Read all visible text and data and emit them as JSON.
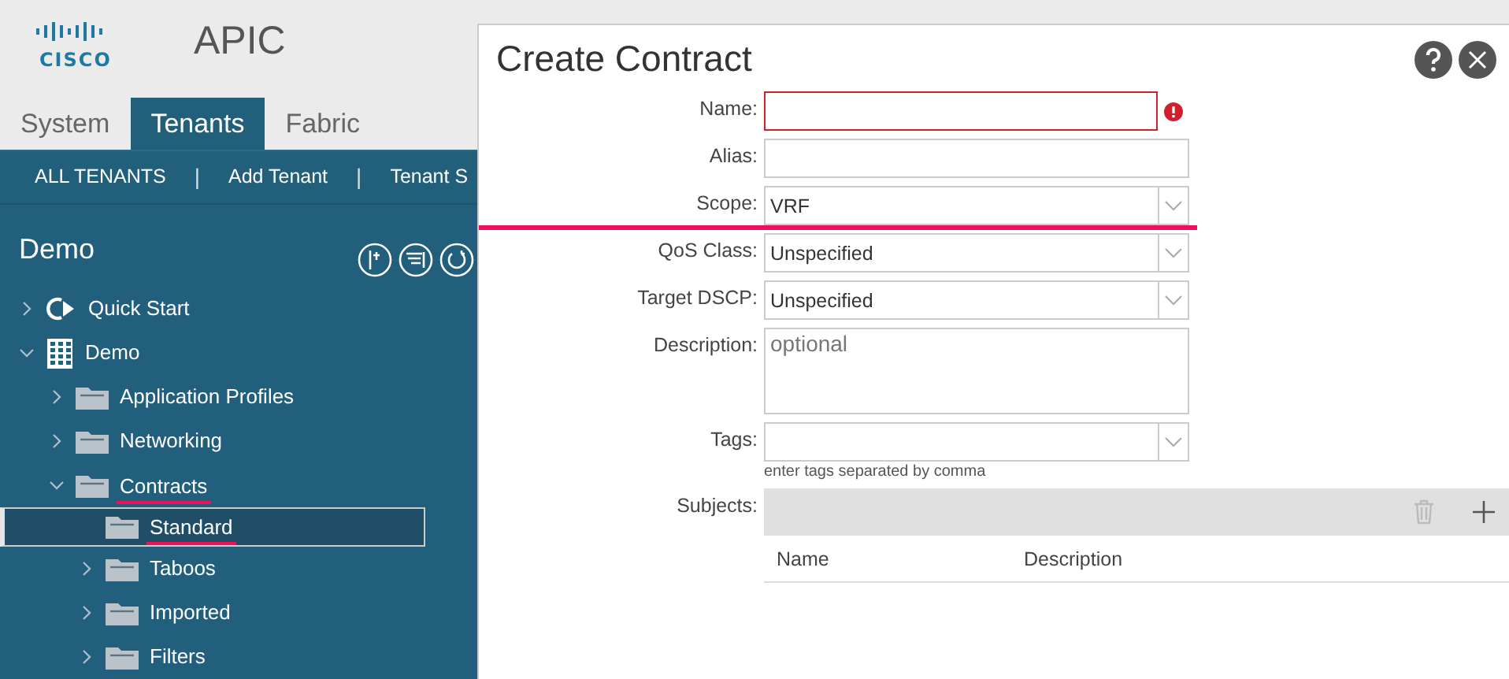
{
  "header": {
    "logo": "CISCO",
    "app_name": "APIC"
  },
  "tabs": [
    {
      "label": "System",
      "selected": false
    },
    {
      "label": "Tenants",
      "selected": true
    },
    {
      "label": "Fabric",
      "selected": false
    }
  ],
  "subnav": [
    {
      "kind": "link",
      "text": "ALL TENANTS"
    },
    {
      "kind": "separator",
      "text": "|"
    },
    {
      "kind": "link",
      "text": "Add Tenant"
    },
    {
      "kind": "separator",
      "text": "|"
    },
    {
      "kind": "link",
      "text": "Tenant S"
    }
  ],
  "sidebar": {
    "title": "Demo",
    "tree": [
      {
        "label": "Quick Start",
        "kind": "quickstart",
        "expanded": false,
        "selected": false,
        "underlined": false
      },
      {
        "label": "Demo",
        "kind": "tenant",
        "expanded": true,
        "selected": false,
        "underlined": false,
        "children": [
          {
            "label": "Application Profiles",
            "kind": "folder",
            "expanded": false,
            "selected": false,
            "underlined": false
          },
          {
            "label": "Networking",
            "kind": "folder",
            "expanded": false,
            "selected": false,
            "underlined": false
          },
          {
            "label": "Contracts",
            "kind": "folder",
            "expanded": true,
            "selected": false,
            "underlined": true,
            "children": [
              {
                "label": "Standard",
                "kind": "folder",
                "leaf": true,
                "expanded": false,
                "selected": true,
                "underlined": true
              },
              {
                "label": "Taboos",
                "kind": "folder",
                "expanded": false,
                "selected": false,
                "underlined": false
              },
              {
                "label": "Imported",
                "kind": "folder",
                "expanded": false,
                "selected": false,
                "underlined": false
              },
              {
                "label": "Filters",
                "kind": "folder",
                "expanded": false,
                "selected": false,
                "underlined": false
              }
            ]
          }
        ]
      }
    ]
  },
  "dialog": {
    "title": "Create Contract",
    "fields": [
      {
        "label": "Name:",
        "kind": "text",
        "error": true,
        "underlined": false
      },
      {
        "label": "Alias:",
        "kind": "text",
        "error": false,
        "underlined": false
      },
      {
        "label": "Scope:",
        "kind": "select",
        "value": "VRF",
        "underlined": true
      },
      {
        "label": "QoS Class:",
        "kind": "select",
        "value": "Unspecified",
        "underlined": false
      },
      {
        "label": "Target DSCP:",
        "kind": "select",
        "value": "Unspecified",
        "underlined": false
      },
      {
        "label": "Description:",
        "kind": "textarea",
        "placeholder": "optional",
        "underlined": false
      },
      {
        "label": "Tags:",
        "kind": "select",
        "hint": "enter tags separated by comma",
        "underlined": false
      }
    ],
    "subjects": {
      "label": "Subjects:",
      "columns": [
        "Name",
        "Description"
      ]
    }
  }
}
